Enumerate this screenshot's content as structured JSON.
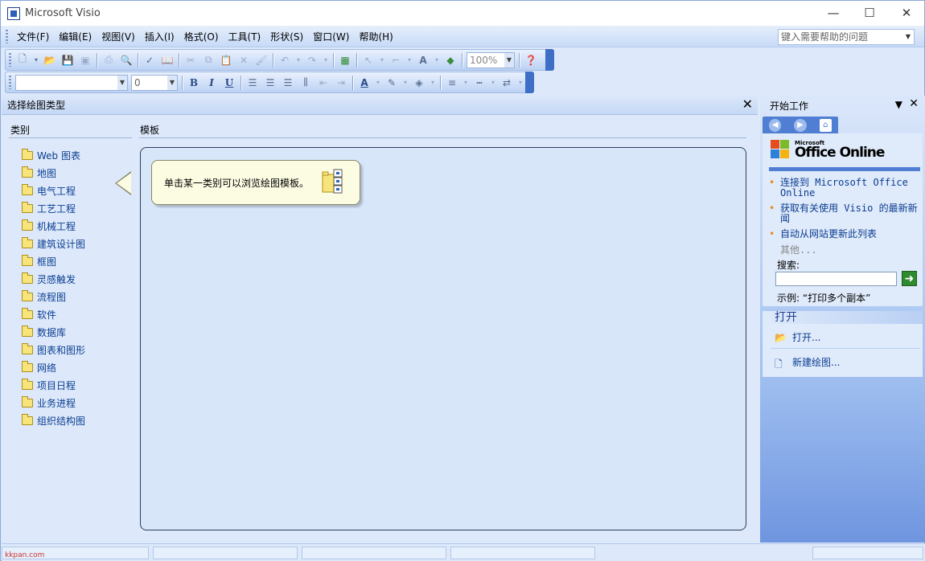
{
  "window": {
    "title": "Microsoft Visio",
    "minimize": "—",
    "maximize": "☐",
    "close": "✕"
  },
  "menubar": {
    "items": [
      "文件(F)",
      "编辑(E)",
      "视图(V)",
      "插入(I)",
      "格式(O)",
      "工具(T)",
      "形状(S)",
      "窗口(W)",
      "帮助(H)"
    ],
    "help_placeholder": "键入需要帮助的问题"
  },
  "toolbar_standard": {
    "zoom_value": "100%",
    "icons": [
      "new-icon",
      "open-icon",
      "save-icon",
      "permission-icon",
      "print-icon",
      "print-preview-icon",
      "spelling-icon",
      "research-icon",
      "cut-icon",
      "copy-icon",
      "paste-icon",
      "delete-icon",
      "format-painter-icon",
      "undo-icon",
      "redo-icon",
      "shapes-icon",
      "pointer-tool-icon",
      "connector-tool-icon",
      "text-tool-icon",
      "stamp-icon",
      "help-icon"
    ]
  },
  "toolbar_formatting": {
    "font_value": "",
    "size_value": "0",
    "bold": "B",
    "italic": "I",
    "underline": "U"
  },
  "main": {
    "header_title": "选择绘图类型",
    "category_heading": "类别",
    "template_heading": "模板",
    "callout_text": "单击某一类别可以浏览绘图模板。",
    "categories": [
      "Web 图表",
      "地图",
      "电气工程",
      "工艺工程",
      "机械工程",
      "建筑设计图",
      "框图",
      "灵感触发",
      "流程图",
      "软件",
      "数据库",
      "图表和图形",
      "网络",
      "项目日程",
      "业务进程",
      "组织结构图"
    ]
  },
  "task_pane": {
    "title": "开始工作",
    "logo_small": "Microsoft",
    "logo_big": "Office Online",
    "links": [
      "连接到 Microsoft Office Online",
      "获取有关使用 Visio 的最新新闻",
      "自动从网站更新此列表"
    ],
    "more": "其他...",
    "search_label": "搜索:",
    "example": "示例:  “打印多个副本”",
    "open_heading": "打开",
    "open_link": "打开...",
    "new_link": "新建绘图..."
  },
  "watermark": "kkpan.com"
}
